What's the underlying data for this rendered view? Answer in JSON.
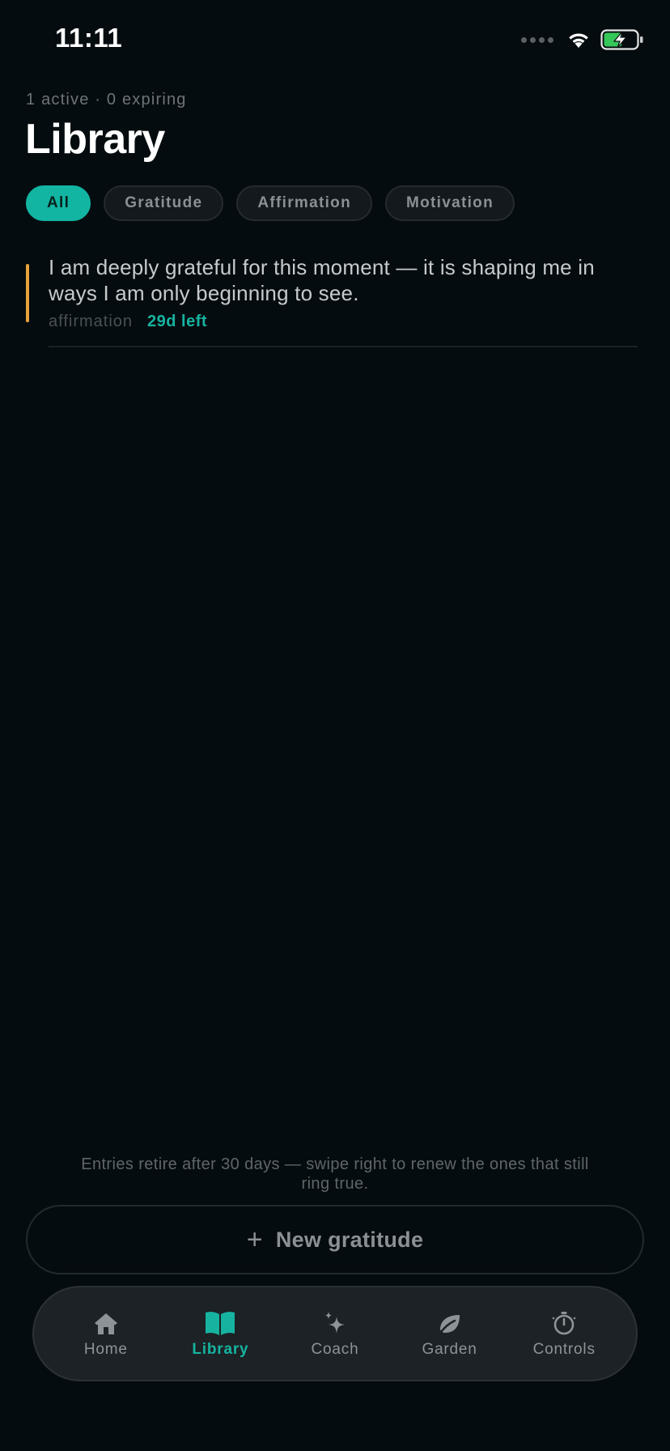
{
  "status_bar": {
    "time": "11:11"
  },
  "header": {
    "subtitle": "1 active · 0 expiring",
    "title": "Library"
  },
  "filters": [
    {
      "label": "All",
      "active": true
    },
    {
      "label": "Gratitude",
      "active": false
    },
    {
      "label": "Affirmation",
      "active": false
    },
    {
      "label": "Motivation",
      "active": false
    }
  ],
  "entries": [
    {
      "text": "I am deeply grateful for this moment — it is shaping me in ways I am only beginning to see.",
      "type": "affirmation",
      "remaining": "29d left",
      "accent_color": "#e7a33a"
    }
  ],
  "footer": {
    "note": "Entries retire after 30 days — swipe right to renew the ones that still ring true.",
    "new_button_label": "New gratitude"
  },
  "tabs": [
    {
      "label": "Home",
      "icon": "home-icon",
      "active": false
    },
    {
      "label": "Library",
      "icon": "book-icon",
      "active": true
    },
    {
      "label": "Coach",
      "icon": "sparkle-icon",
      "active": false
    },
    {
      "label": "Garden",
      "icon": "leaf-icon",
      "active": false
    },
    {
      "label": "Controls",
      "icon": "timer-icon",
      "active": false
    }
  ],
  "colors": {
    "accent": "#12b5a2",
    "background": "#050c0f",
    "entry_accent": "#e7a33a"
  }
}
